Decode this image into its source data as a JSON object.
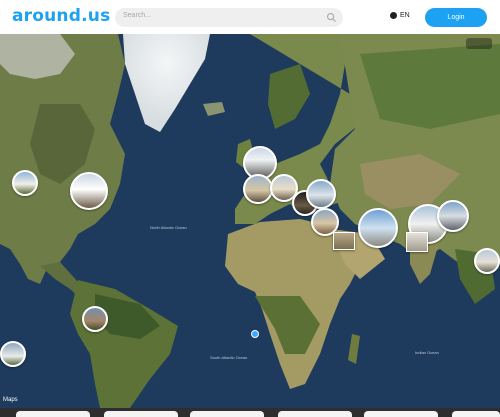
{
  "header": {
    "logo": "around.us",
    "search_placeholder": "Search...",
    "language": "EN",
    "login_label": "Login"
  },
  "map": {
    "attribution": "Maps",
    "labels": {
      "north_atlantic": "North Atlantic Ocean",
      "south_atlantic": "South Atlantic Ocean",
      "indian": "Indian Ocean"
    }
  },
  "colors": {
    "brand": "#1da1f2",
    "ocean": "#1d3a5c",
    "land": "#6f7d45"
  },
  "icons": [
    "search-icon",
    "globe-icon",
    "fullscreen-icon"
  ]
}
